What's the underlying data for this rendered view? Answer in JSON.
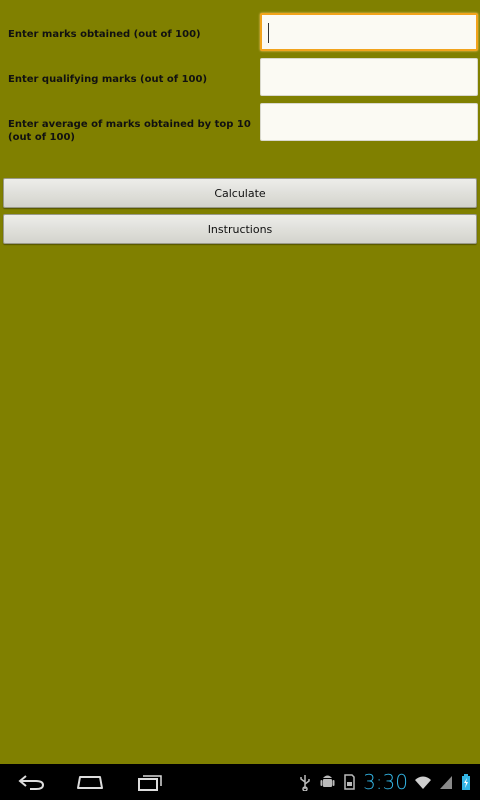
{
  "form": {
    "marks_label": "Enter marks obtained (out of 100)",
    "marks_value": "",
    "qualifying_label": "Enter qualifying marks (out of 100)",
    "qualifying_value": "",
    "average_label": "Enter average of marks obtained by top 10 (out of 100)",
    "average_value": ""
  },
  "buttons": {
    "calculate": "Calculate",
    "instructions": "Instructions"
  },
  "status": {
    "time": "3:30"
  },
  "colors": {
    "background": "#808000",
    "focus": "#f1a31b",
    "clock": "#33b5e5"
  },
  "icons": [
    "back-icon",
    "home-icon",
    "recent-apps-icon",
    "usb-icon",
    "android-debug-icon",
    "sd-card-icon",
    "wifi-icon",
    "signal-icon",
    "battery-icon"
  ]
}
